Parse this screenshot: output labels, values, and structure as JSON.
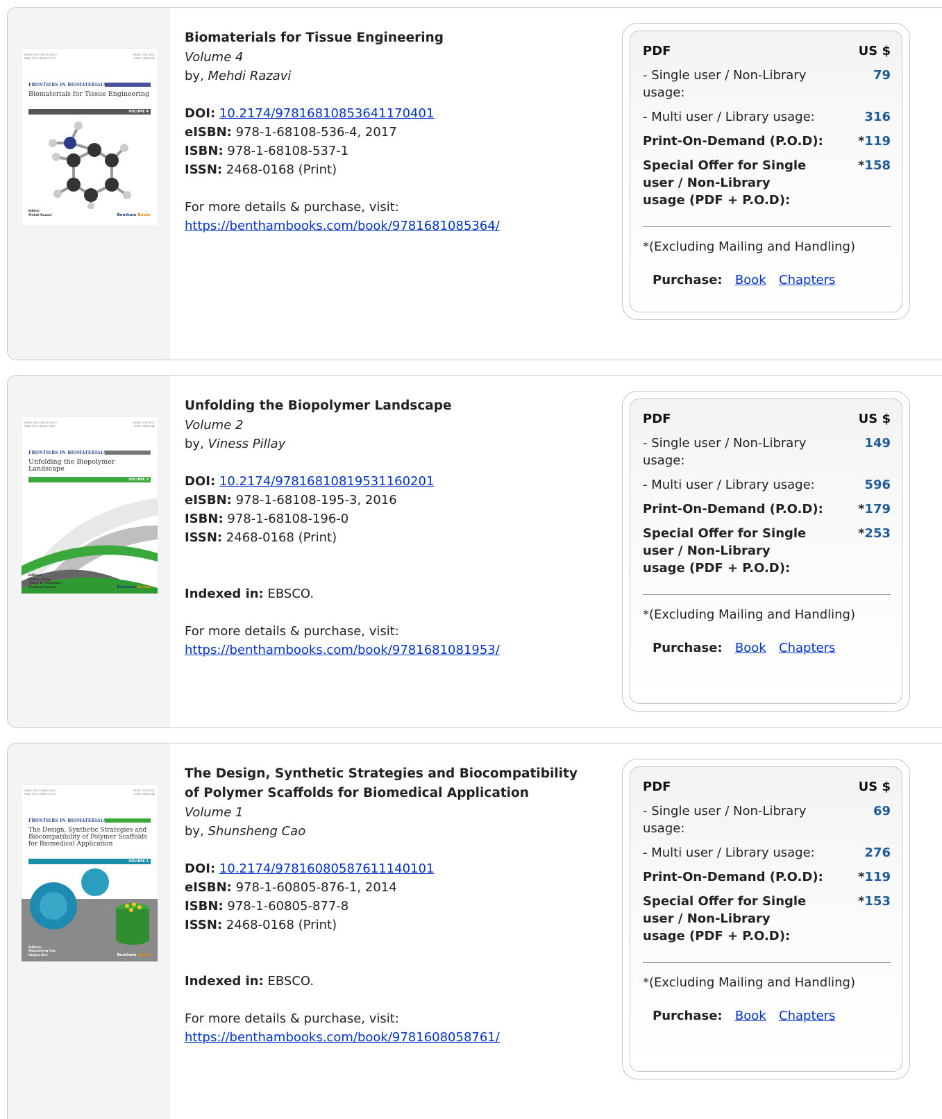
{
  "books": [
    {
      "title": "Biomaterials for Tissue Engineering",
      "volume": "Volume 4",
      "by_prefix": "by, ",
      "author": "Mehdi Razavi",
      "doi_label": "DOI:",
      "doi": "10.2174/97816810853641170401",
      "eisbn_label": "eISBN:",
      "eisbn": "978-1-68108-536-4, 2017",
      "isbn_label": "ISBN:",
      "isbn": "978-1-68108-537-1",
      "issn_label": "ISSN:",
      "issn": "2468-0168 (Print)",
      "indexed_label": "",
      "indexed": "",
      "details_text": "For more details & purchase, visit:",
      "url": "https://benthambooks.com/book/9781681085364/",
      "cover": {
        "isbn_left": "eISBN: 978-1-68108-536-4\nISBN: 978-1-68108-537-1",
        "issn_right": "eISSN: 2352-3921\nISSN: 2468-0168",
        "series": "FRONTIERS IN BIOMATERIALS",
        "title": "Biomaterials for Tissue Engineering",
        "volume": "VOLUME 4",
        "editors_label": "Editor:",
        "editors": "Mehdi Razavi",
        "publisher": "Bentham",
        "publisher_suffix": "Books",
        "accent_color": "#4a4f9a",
        "vol_bar_color": "#555555"
      },
      "price": {
        "header_label": "PDF",
        "header_currency": "US $",
        "single_label": "- Single user / Non-Library usage:",
        "single_value": "79",
        "multi_label": "- Multi user / Library usage:",
        "multi_value": "316",
        "pod_label": "Print-On-Demand (P.O.D):",
        "pod_value": "119",
        "offer_label": "Special Offer for Single user / Non-Library usage (PDF + P.O.D):",
        "offer_value": "158",
        "asterisk": "*",
        "excluding": "*(Excluding Mailing and Handling)",
        "purchase_label": "Purchase:",
        "book_link": "Book",
        "chapters_link": "Chapters"
      }
    },
    {
      "title": "Unfolding the Biopolymer Landscape",
      "volume": "Volume 2",
      "by_prefix": "by, ",
      "author": "Viness Pillay",
      "doi_label": "DOI:",
      "doi": "10.2174/97816810819531160201",
      "eisbn_label": "eISBN:",
      "eisbn": "978-1-68108-195-3, 2016",
      "isbn_label": "ISBN:",
      "isbn": "978-1-68108-196-0",
      "issn_label": "ISSN:",
      "issn": "2468-0168 (Print)",
      "indexed_label": "Indexed in:",
      "indexed": " EBSCO.",
      "details_text": "For more details & purchase, visit:",
      "url": "https://benthambooks.com/book/9781681081953/",
      "cover": {
        "isbn_left": "eISBN: 978-1-68108-195-3\nISBN: 978-1-68108-196-0",
        "issn_right": "eISSN: 2352-3921\nISSN: 2468-0168",
        "series": "FRONTIERS IN BIOMATERIALS",
        "title": "Unfolding the Biopolymer Landscape",
        "volume": "VOLUME 2",
        "editors_label": "Editors:",
        "editors": "Viness Pillay\nYahya E. Choonara\nPradeep Kumar",
        "publisher": "Bentham",
        "publisher_suffix": "Books",
        "accent_color": "#777777",
        "vol_bar_color": "#3aa83a"
      },
      "price": {
        "header_label": "PDF",
        "header_currency": "US $",
        "single_label": "- Single user / Non-Library usage:",
        "single_value": "149",
        "multi_label": "- Multi user / Library usage:",
        "multi_value": "596",
        "pod_label": "Print-On-Demand (P.O.D):",
        "pod_value": "179",
        "offer_label": "Special Offer for Single user / Non-Library usage (PDF + P.O.D):",
        "offer_value": "253",
        "asterisk": "*",
        "excluding": "*(Excluding Mailing and Handling)",
        "purchase_label": "Purchase:",
        "book_link": "Book",
        "chapters_link": "Chapters"
      }
    },
    {
      "title": "The Design, Synthetic Strategies and Biocompatibility of Polymer Scaffolds for Biomedical Application",
      "volume": "Volume 1",
      "by_prefix": "by, ",
      "author": "Shunsheng Cao",
      "doi_label": "DOI:",
      "doi": "10.2174/97816080587611140101",
      "eisbn_label": "eISBN:",
      "eisbn": "978-1-60805-876-1, 2014",
      "isbn_label": "ISBN:",
      "isbn": "978-1-60805-877-8",
      "issn_label": "ISSN:",
      "issn": "2468-0168 (Print)",
      "indexed_label": "Indexed in:",
      "indexed": " EBSCO.",
      "details_text": "For more details & purchase, visit:",
      "url": "https://benthambooks.com/book/9781608058761/",
      "cover": {
        "isbn_left": "eISBN: 978-1-60805-876-1\nISBN: 978-1-60805-877-8",
        "issn_right": "eISSN: 2352-3921\nISSN: 2468-0168",
        "series": "FRONTIERS IN BIOMATERIALS",
        "title": "The Design, Synthetic Strategies and Biocompatibility of Polymer Scaffolds for Biomedical Application",
        "volume": "VOLUME 1",
        "editors_label": "Editors:",
        "editors": "Shunsheng Cao\nHuijun Zhu",
        "publisher": "Bentham",
        "publisher_suffix": "Books",
        "accent_color": "#3aa83a",
        "vol_bar_color": "#1c8ea6"
      },
      "price": {
        "header_label": "PDF",
        "header_currency": "US $",
        "single_label": "- Single user / Non-Library usage:",
        "single_value": "69",
        "multi_label": "- Multi user / Library usage:",
        "multi_value": "276",
        "pod_label": "Print-On-Demand (P.O.D):",
        "pod_value": "119",
        "offer_label": "Special Offer for Single user / Non-Library usage (PDF + P.O.D):",
        "offer_value": "153",
        "asterisk": "*",
        "excluding": "*(Excluding Mailing and Handling)",
        "purchase_label": "Purchase:",
        "book_link": "Book",
        "chapters_link": "Chapters"
      }
    }
  ]
}
